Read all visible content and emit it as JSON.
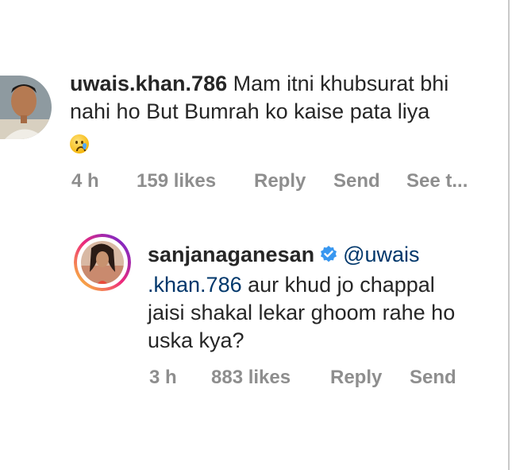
{
  "comments": [
    {
      "username": "uwais.khan.786",
      "text_line1": "Mam itni khubsurat bhi",
      "text_line2": "nahi ho But Bumrah ko kaise pata liya",
      "emoji": "😢",
      "time": "4 h",
      "likes": "159 likes",
      "reply_label": "Reply",
      "send_label": "Send",
      "see_translation_label": "See t..."
    },
    {
      "username": "sanjanaganesan",
      "verified": true,
      "mention_part1": "@uwais",
      "mention_part2": ".khan.786",
      "text_line2_rest": " aur khud jo chappal",
      "text_line3": "jaisi shakal lekar ghoom rahe ho",
      "text_line4": "uska kya?",
      "time": "3 h",
      "likes": "883 likes",
      "reply_label": "Reply",
      "send_label": "Send"
    }
  ],
  "colors": {
    "text": "#262626",
    "meta": "#8e8e8e",
    "mention": "#00376b",
    "verified_badge": "#3897f0",
    "story_ring": [
      "#f9ce34",
      "#ee2a7b",
      "#6228d7"
    ]
  }
}
